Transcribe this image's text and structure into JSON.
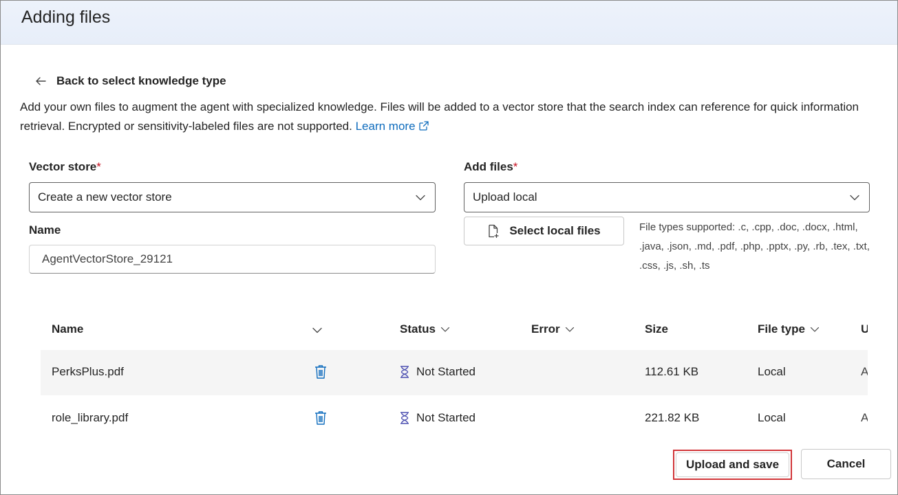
{
  "header": {
    "title": "Adding files"
  },
  "back": {
    "label": "Back to select knowledge type"
  },
  "description": {
    "text": "Add your own files to augment the agent with specialized knowledge. Files will be added to a vector store that the search index can reference for quick information retrieval. Encrypted or sensitivity-labeled files are not supported.",
    "link_label": "Learn more"
  },
  "vector_store": {
    "label": "Vector store",
    "required_mark": "*",
    "value": "Create a new vector store"
  },
  "name_field": {
    "label": "Name",
    "value": "AgentVectorStore_29121"
  },
  "add_files": {
    "label": "Add files",
    "required_mark": "*",
    "value": "Upload local"
  },
  "select_files_button": {
    "label": "Select local files"
  },
  "file_types_text": "File types supported: .c, .cpp, .doc, .docx, .html, .java, .json, .md, .pdf, .php, .pptx, .py, .rb, .tex, .txt, .css, .js, .sh, .ts",
  "table": {
    "columns": {
      "name": "Name",
      "status": "Status",
      "error": "Error",
      "size": "Size",
      "file_type": "File type",
      "truncated": "U"
    },
    "rows": [
      {
        "name": "PerksPlus.pdf",
        "status": "Not Started",
        "size": "112.61 KB",
        "file_type": "Local",
        "truncated": "A"
      },
      {
        "name": "role_library.pdf",
        "status": "Not Started",
        "size": "221.82 KB",
        "file_type": "Local",
        "truncated": "A"
      }
    ]
  },
  "footer": {
    "upload_label": "Upload and save",
    "cancel_label": "Cancel"
  },
  "colors": {
    "accent": "#0f6cbd",
    "required": "#c50f1f",
    "highlight": "#d13438",
    "status_icon": "#4f52b2"
  }
}
